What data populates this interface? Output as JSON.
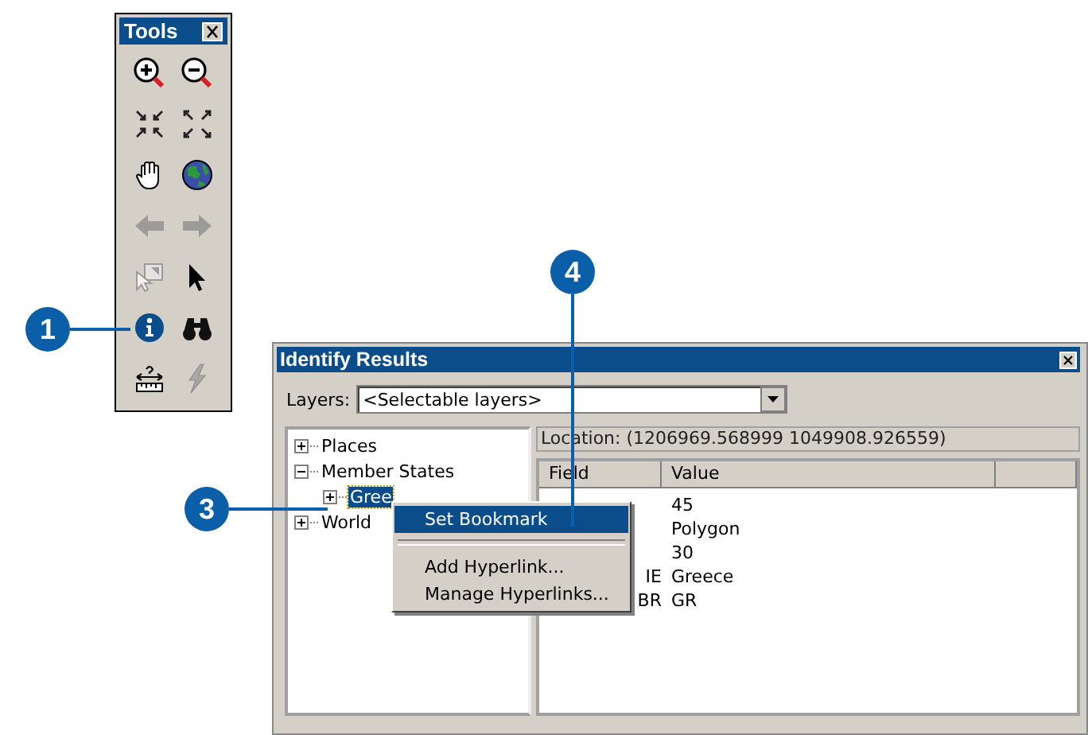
{
  "tools_window": {
    "title": "Tools",
    "tools": [
      {
        "kind": "zoom-in",
        "disabled": false
      },
      {
        "kind": "zoom-out",
        "disabled": false
      },
      {
        "kind": "fixed-zoom-in",
        "disabled": false
      },
      {
        "kind": "fixed-zoom-out",
        "disabled": false
      },
      {
        "kind": "pan",
        "disabled": false
      },
      {
        "kind": "full-extent",
        "disabled": false
      },
      {
        "kind": "back",
        "disabled": true
      },
      {
        "kind": "forward",
        "disabled": true
      },
      {
        "kind": "select-features",
        "disabled": true
      },
      {
        "kind": "select-elements",
        "disabled": false
      },
      {
        "kind": "identify",
        "disabled": false
      },
      {
        "kind": "find",
        "disabled": false
      },
      {
        "kind": "measure",
        "disabled": false
      },
      {
        "kind": "hyperlink",
        "disabled": true
      }
    ]
  },
  "callouts": [
    {
      "number": "1"
    },
    {
      "number": "3"
    },
    {
      "number": "4"
    }
  ],
  "identify_window": {
    "title": "Identify Results",
    "layers_label": "Layers:",
    "layers_value": "<Selectable layers>",
    "tree": [
      {
        "label": "Places",
        "expanded": false,
        "selected": false
      },
      {
        "label": "Member States",
        "expanded": true,
        "selected": false,
        "children": [
          {
            "label": "Gree",
            "expanded": false,
            "selected": true
          }
        ]
      },
      {
        "label": "World",
        "expanded": false,
        "selected": false
      }
    ],
    "location": "Location: (1206969.568999 1049908.926559)",
    "columns": [
      "Field",
      "Value"
    ],
    "rows": [
      {
        "value": "45"
      },
      {
        "value": "Polygon"
      },
      {
        "value": "30"
      },
      {
        "field": "IE",
        "value": "Greece"
      },
      {
        "field": "BR",
        "value": "GR"
      }
    ]
  },
  "context_menu": {
    "items": [
      {
        "kind": "item",
        "label": "Set Bookmark",
        "selected": true
      },
      {
        "kind": "separator"
      },
      {
        "kind": "item",
        "label": "Add Hyperlink...",
        "selected": false
      },
      {
        "kind": "item",
        "label": "Manage Hyperlinks...",
        "selected": false
      }
    ]
  }
}
